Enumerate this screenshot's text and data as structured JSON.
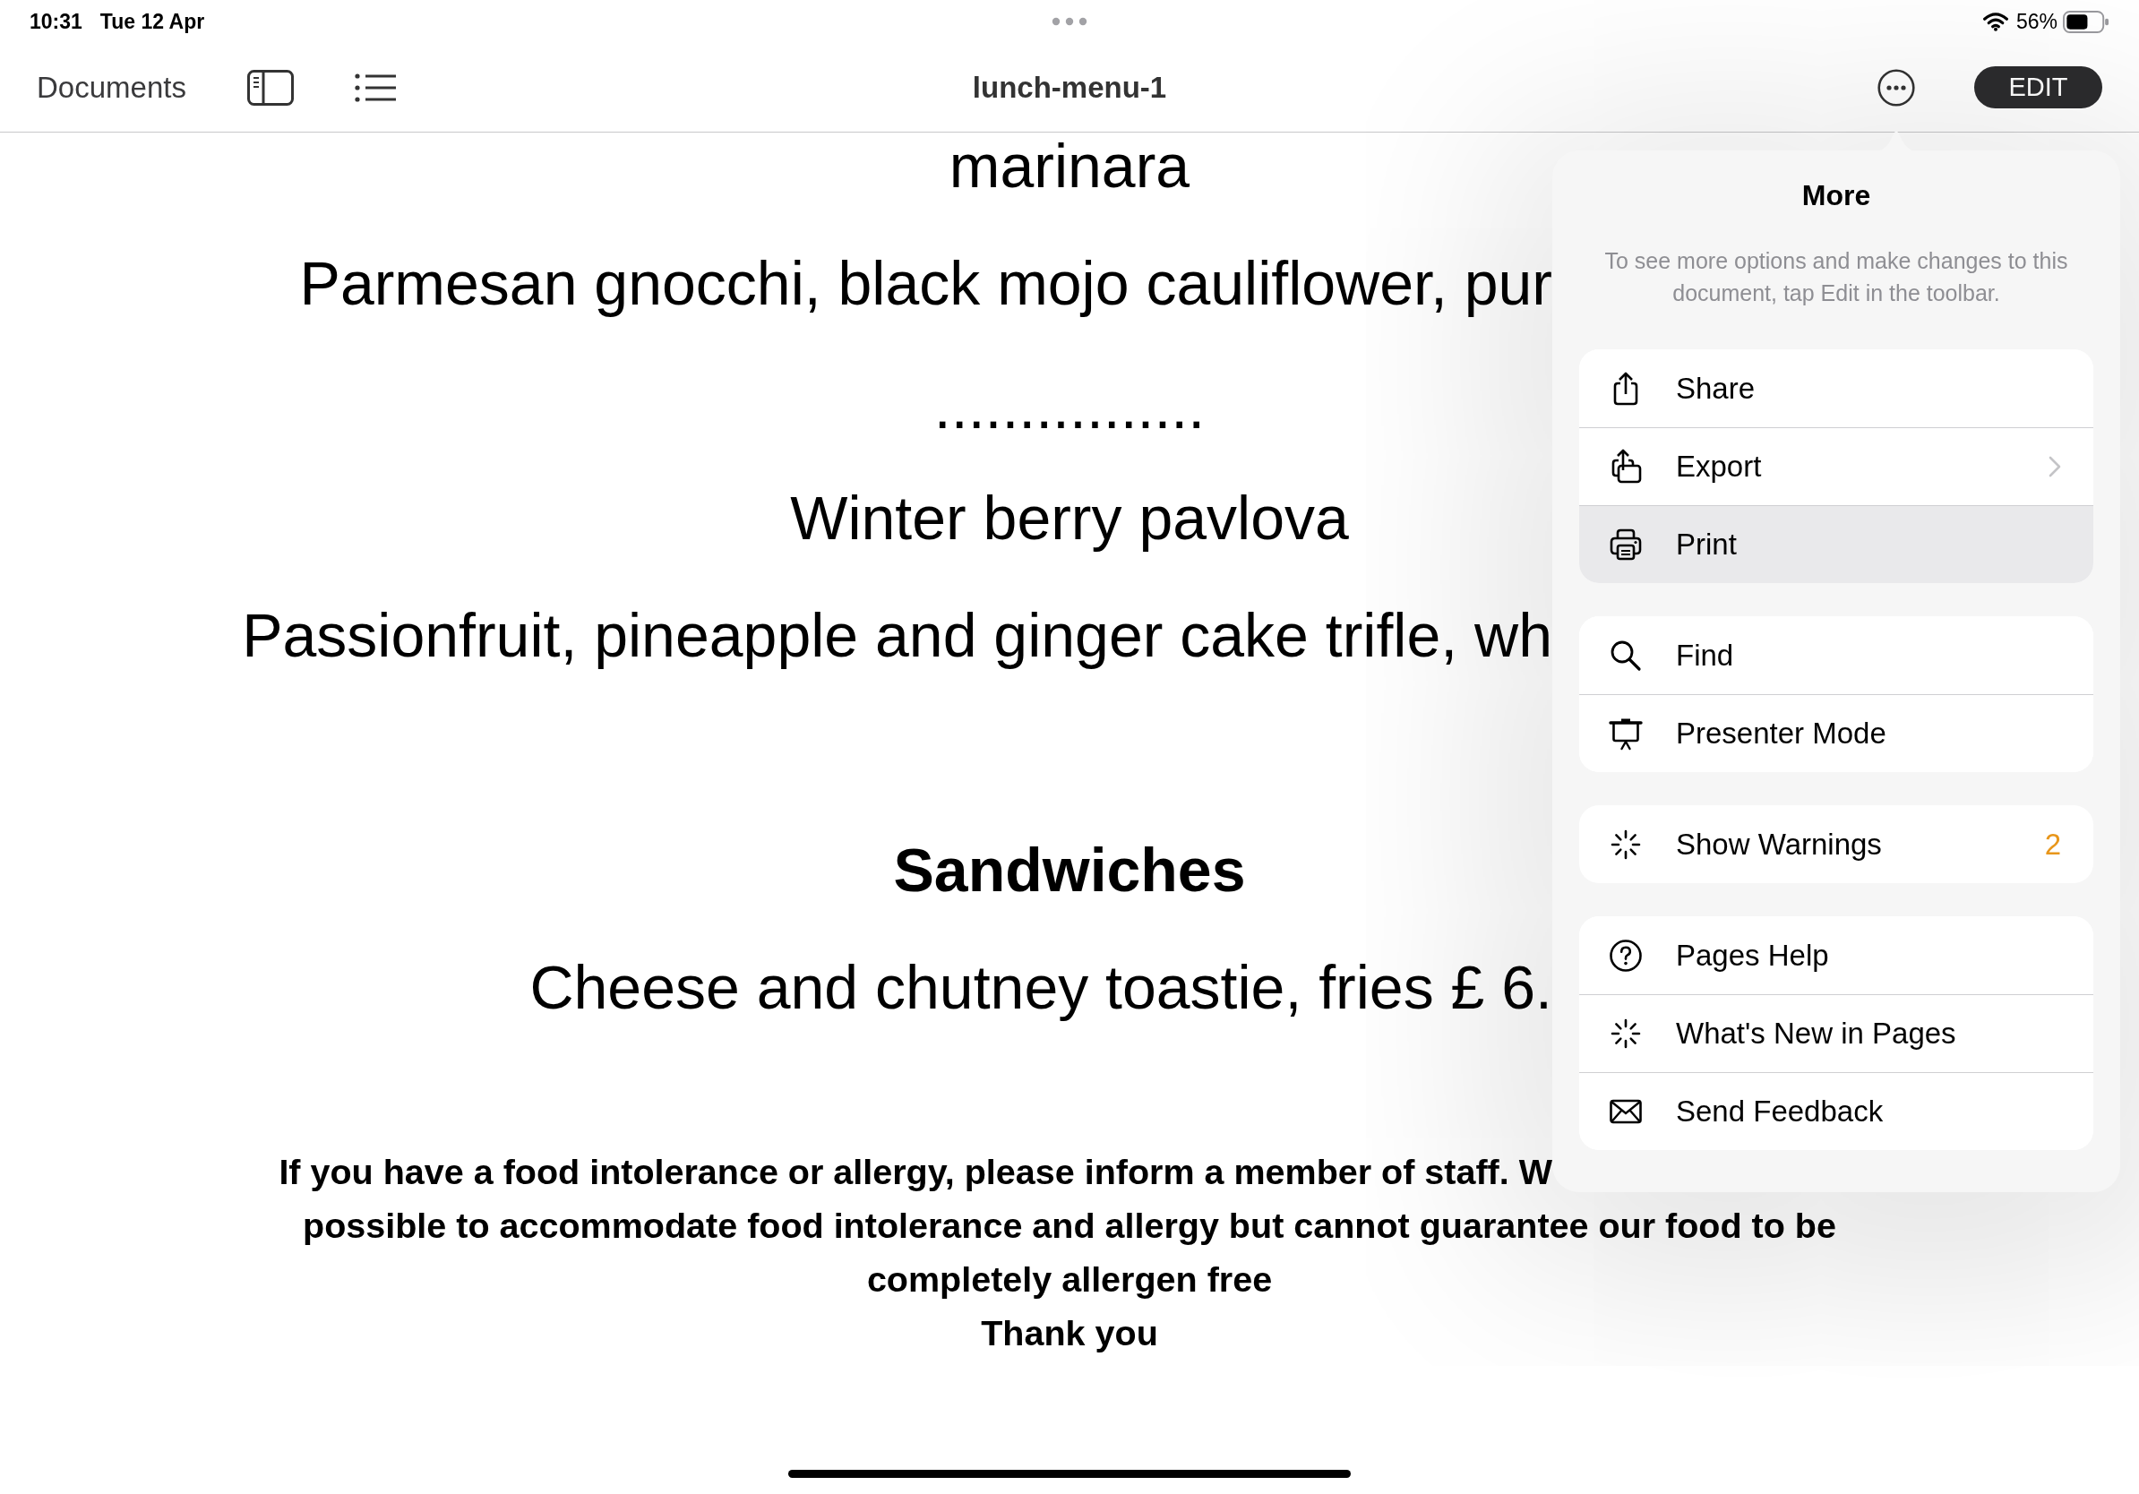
{
  "status_bar": {
    "time": "10:31",
    "date": "Tue 12 Apr",
    "battery": "56%"
  },
  "toolbar": {
    "back_label": "Documents",
    "title": "lunch-menu-1",
    "edit_label": "EDIT"
  },
  "document": {
    "lines": [
      {
        "kind": "text",
        "text": "marinara"
      },
      {
        "kind": "clipped",
        "text": "Parmesan gnocchi, black mojo cauliflower, pur"
      },
      {
        "kind": "separator",
        "text": "................"
      },
      {
        "kind": "text",
        "text": "Winter berry pavlova"
      },
      {
        "kind": "clipped",
        "text": "Passionfruit, pineapple and ginger cake trifle, wh"
      },
      {
        "kind": "heading",
        "text": "Sandwiches"
      },
      {
        "kind": "clipped",
        "text": "Cheese and chutney toastie, fries £ 6."
      }
    ],
    "notice": [
      {
        "kind": "clipped",
        "text": "If you have a food intolerance or allergy, please inform a member of staff. W"
      },
      {
        "kind": "text",
        "text": "possible to accommodate food intolerance and allergy but cannot guarantee our food to be"
      },
      {
        "kind": "text",
        "text": "completely allergen free"
      },
      {
        "kind": "text",
        "text": "Thank you"
      }
    ]
  },
  "more_menu": {
    "title": "More",
    "description": "To see more options and make changes to this document, tap Edit in the toolbar.",
    "groups": [
      {
        "items": [
          {
            "label": "Share",
            "highlighted": false,
            "submenu": false
          },
          {
            "label": "Export",
            "highlighted": false,
            "submenu": true
          },
          {
            "label": "Print",
            "highlighted": true,
            "submenu": false
          }
        ]
      },
      {
        "items": [
          {
            "label": "Find",
            "highlighted": false,
            "submenu": false
          },
          {
            "label": "Presenter Mode",
            "highlighted": false,
            "submenu": false
          }
        ]
      },
      {
        "items": [
          {
            "label": "Show Warnings",
            "highlighted": false,
            "submenu": false,
            "count": "2"
          }
        ]
      },
      {
        "items": [
          {
            "label": "Pages Help",
            "highlighted": false,
            "submenu": false
          },
          {
            "label": "What's New in Pages",
            "highlighted": false,
            "submenu": false
          },
          {
            "label": "Send Feedback",
            "highlighted": false,
            "submenu": false
          }
        ]
      }
    ]
  }
}
